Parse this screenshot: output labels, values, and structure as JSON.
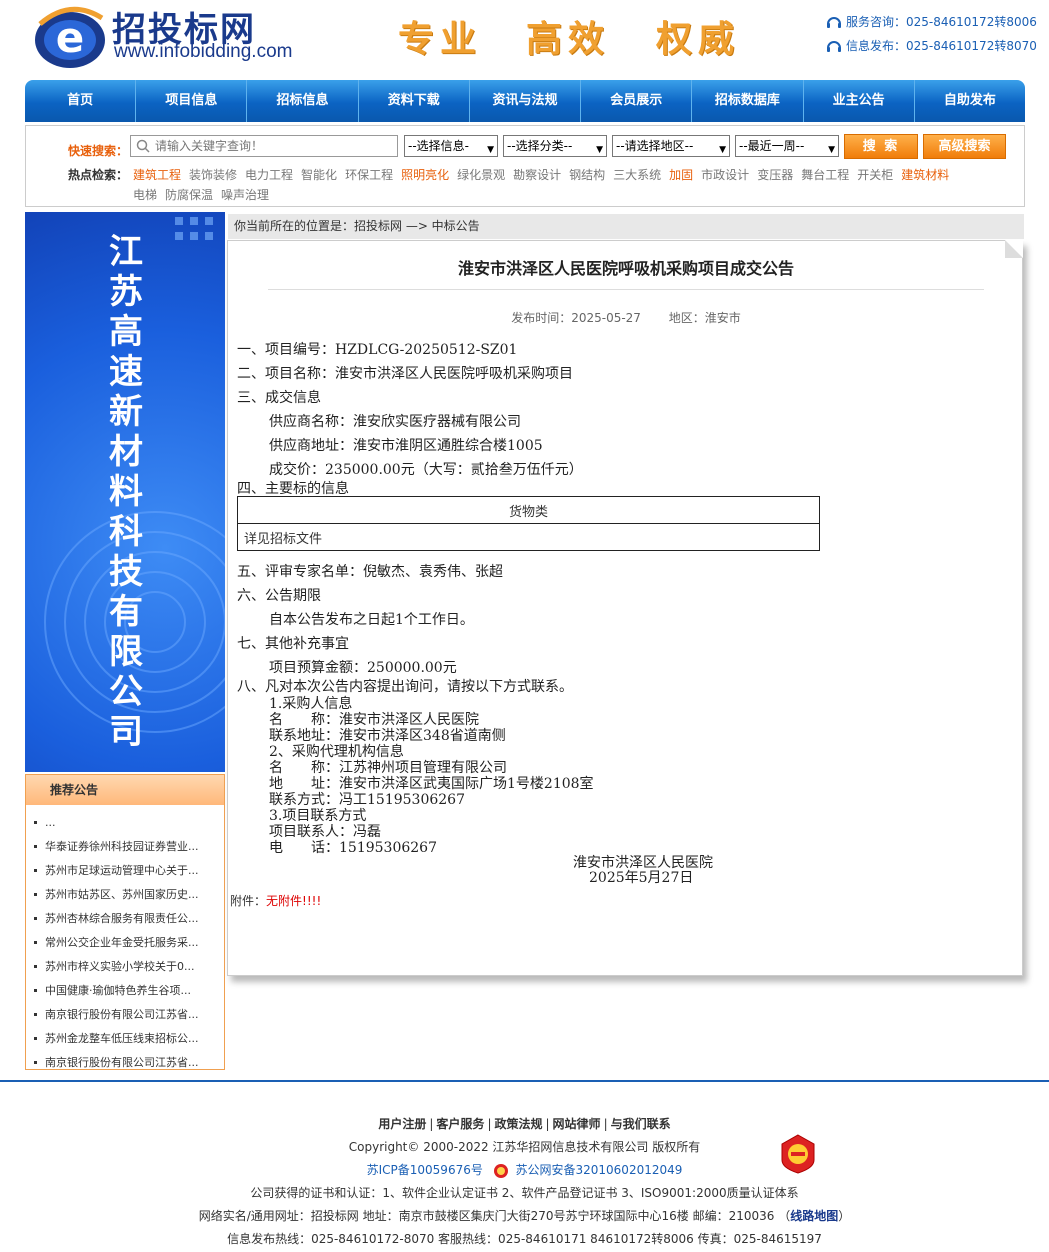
{
  "header": {
    "logo_name": "招投标网",
    "logo_url": "www.infobidding.com",
    "slogans": [
      "专业",
      "高效",
      "权威"
    ],
    "hotlines": [
      {
        "label": "服务咨询：",
        "number": "025-84610172转8006"
      },
      {
        "label": "信息发布：",
        "number": "025-84610172转8070"
      }
    ]
  },
  "nav": [
    "首页",
    "项目信息",
    "招标信息",
    "资料下载",
    "资讯与法规",
    "会员展示",
    "招标数据库",
    "业主公告",
    "自助发布"
  ],
  "search": {
    "label": "快速搜索：",
    "placeholder": "请输入关键字查询！",
    "selects": [
      "--选择信息-",
      "--选择分类--",
      "--请选择地区--",
      "--最近一周--"
    ],
    "search_button": "搜 索",
    "advanced_button": "高级搜索",
    "hot_label": "热点检索：",
    "hot_row1": [
      {
        "t": "建筑工程",
        "hl": true
      },
      {
        "t": "装饰装修",
        "hl": false
      },
      {
        "t": "电力工程",
        "hl": false
      },
      {
        "t": "智能化",
        "hl": false
      },
      {
        "t": "环保工程",
        "hl": false
      },
      {
        "t": "照明亮化",
        "hl": true
      },
      {
        "t": "绿化景观",
        "hl": false
      },
      {
        "t": "勘察设计",
        "hl": false
      },
      {
        "t": "钢结构",
        "hl": false
      },
      {
        "t": "三大系统",
        "hl": false
      },
      {
        "t": "加固",
        "hl": true
      },
      {
        "t": "市政设计",
        "hl": false
      },
      {
        "t": "变压器",
        "hl": false
      },
      {
        "t": "舞台工程",
        "hl": false
      },
      {
        "t": "开关柜",
        "hl": false
      },
      {
        "t": "建筑材料",
        "hl": true
      }
    ],
    "hot_row2": [
      {
        "t": "电梯",
        "hl": false
      },
      {
        "t": "防腐保温",
        "hl": false
      },
      {
        "t": "噪声治理",
        "hl": false
      }
    ]
  },
  "banner": {
    "text": "江苏高速新材料科技有限公司"
  },
  "recommend": {
    "title": "推荐公告",
    "items": [
      "...",
      "华泰证券徐州科技园证券营业...",
      "苏州市足球运动管理中心关于...",
      "苏州市姑苏区、苏州国家历史...",
      "苏州杏林综合服务有限责任公...",
      "常州公交企业年金受托服务采...",
      "苏州市梓义实验小学校关于0...",
      "中国健康·瑜伽特色养生谷项...",
      "南京银行股份有限公司江苏省...",
      "苏州金龙整车低压线束招标公...",
      "南京银行股份有限公司江苏省..."
    ]
  },
  "breadcrumb": "你当前所在的位置是：招投标网 —> 中标公告",
  "doc": {
    "title": "淮安市洪泽区人民医院呼吸机采购项目成交公告",
    "publish_label": "发布时间：",
    "publish_date": "2025-05-27",
    "region_label": "地区：",
    "region": "淮安市",
    "lines": [
      "一、项目编号：HZDLCG-20250512-SZ01",
      "二、项目名称：淮安市洪泽区人民医院呼吸机采购项目",
      "三、成交信息",
      "供应商名称：淮安欣实医疗器械有限公司",
      "供应商地址：淮安市淮阴区通胜综合楼1005",
      "成交价：235000.00元（大写：贰拾叁万伍仟元）",
      "四、主要标的信息",
      "五、评审专家名单：倪敏杰、袁秀伟、张超",
      "六、公告期限",
      "自本公告发布之日起1个工作日。",
      "七、其他补充事宜",
      "项目预算金额：250000.00元",
      "八、凡对本次公告内容提出询问，请按以下方式联系。",
      "1.采购人信息",
      "名　　称：淮安市洪泽区人民医院",
      "联系地址：淮安市洪泽区348省道南侧",
      "2、采购代理机构信息",
      "名　　称：江苏神州项目管理有限公司",
      "地　　址：淮安市洪泽区武夷国际广场1号楼2108室",
      "联系方式：冯工15195306267",
      "3.项目联系方式",
      "项目联系人：冯磊",
      "电　　话：15195306267",
      "淮安市洪泽区人民医院",
      "2025年5月27日"
    ],
    "table": {
      "header": "货物类",
      "cell": "详见招标文件"
    },
    "attach_label": "附件：",
    "attach_value": "无附件!!!!"
  },
  "footer": {
    "links": [
      "用户注册",
      "客户服务",
      "政策法规",
      "网站律师",
      "与我们联系"
    ],
    "copyright": "Copyright© 2000-2022 江苏华招网信息技术有限公司 版权所有",
    "icp": "苏ICP备10059676号",
    "police": "苏公网安备32010602012049",
    "certs": "公司获得的证书和认证：1、软件企业认定证书 2、软件产品登记证书 3、ISO9001:2000质量认证体系",
    "address_prefix": "网络实名/通用网址：招投标网 地址：南京市鼓楼区集庆门大街270号苏宁环球国际中心16楼 邮编：210036 （",
    "map_link": "线路地图",
    "address_suffix": "）",
    "phones": "信息发布热线：025-84610172-8070 客服热线：025-84610171 84610172转8006 传真：025-84615197"
  }
}
